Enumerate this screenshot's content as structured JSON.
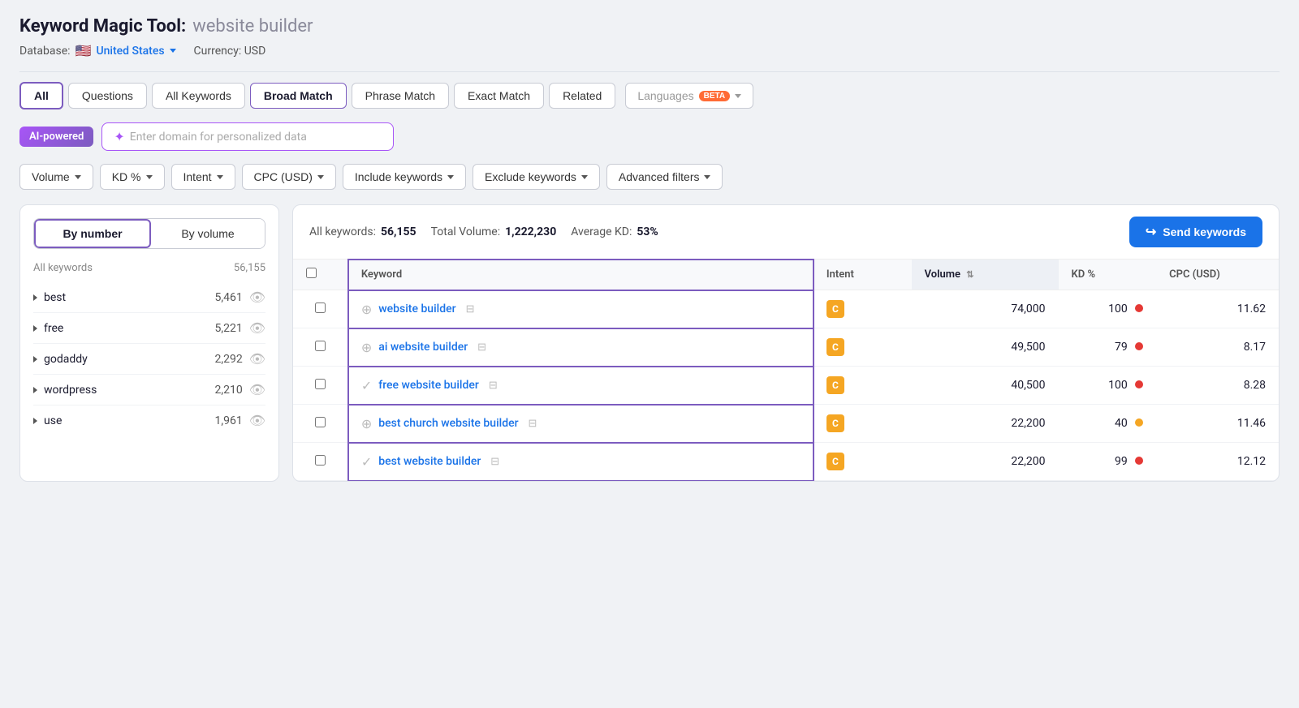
{
  "header": {
    "title_main": "Keyword Magic Tool:",
    "title_sub": "website builder",
    "db_label": "Database:",
    "country": "United States",
    "currency_label": "Currency: USD"
  },
  "tabs": {
    "items": [
      {
        "label": "All",
        "active": true
      },
      {
        "label": "Questions",
        "active": false
      },
      {
        "label": "All Keywords",
        "active": false
      },
      {
        "label": "Broad Match",
        "active": true,
        "selected": true
      },
      {
        "label": "Phrase Match",
        "active": false
      },
      {
        "label": "Exact Match",
        "active": false
      },
      {
        "label": "Related",
        "active": false
      }
    ],
    "languages_label": "Languages",
    "beta_label": "beta"
  },
  "ai_bar": {
    "badge_label": "AI-powered",
    "placeholder": "Enter domain for personalized data"
  },
  "filters": {
    "items": [
      {
        "label": "Volume"
      },
      {
        "label": "KD %"
      },
      {
        "label": "Intent"
      },
      {
        "label": "CPC (USD)"
      },
      {
        "label": "Include keywords"
      },
      {
        "label": "Exclude keywords"
      },
      {
        "label": "Advanced filters"
      }
    ]
  },
  "sidebar": {
    "toggle_by_number": "By number",
    "toggle_by_volume": "By volume",
    "header_label": "All keywords",
    "header_count": "56,155",
    "rows": [
      {
        "keyword": "best",
        "count": "5,461"
      },
      {
        "keyword": "free",
        "count": "5,221"
      },
      {
        "keyword": "godaddy",
        "count": "2,292"
      },
      {
        "keyword": "wordpress",
        "count": "2,210"
      },
      {
        "keyword": "use",
        "count": "1,961"
      }
    ]
  },
  "table": {
    "stats": {
      "all_keywords_label": "All keywords:",
      "all_keywords_value": "56,155",
      "total_volume_label": "Total Volume:",
      "total_volume_value": "1,222,230",
      "avg_kd_label": "Average KD:",
      "avg_kd_value": "53%"
    },
    "send_button_label": "Send keywords",
    "columns": {
      "keyword": "Keyword",
      "intent": "Intent",
      "volume": "Volume",
      "kd": "KD %",
      "cpc": "CPC (USD)"
    },
    "rows": [
      {
        "keyword": "website builder",
        "intent": "C",
        "volume": "74,000",
        "kd": "100",
        "kd_color": "red",
        "cpc": "11.62",
        "icon_type": "plus"
      },
      {
        "keyword": "ai website builder",
        "intent": "C",
        "volume": "49,500",
        "kd": "79",
        "kd_color": "red",
        "cpc": "8.17",
        "icon_type": "plus"
      },
      {
        "keyword": "free website builder",
        "intent": "C",
        "volume": "40,500",
        "kd": "100",
        "kd_color": "red",
        "cpc": "8.28",
        "icon_type": "check"
      },
      {
        "keyword": "best church website builder",
        "intent": "C",
        "volume": "22,200",
        "kd": "40",
        "kd_color": "orange",
        "cpc": "11.46",
        "icon_type": "plus"
      },
      {
        "keyword": "best website builder",
        "intent": "C",
        "volume": "22,200",
        "kd": "99",
        "kd_color": "red",
        "cpc": "12.12",
        "icon_type": "check"
      }
    ]
  }
}
